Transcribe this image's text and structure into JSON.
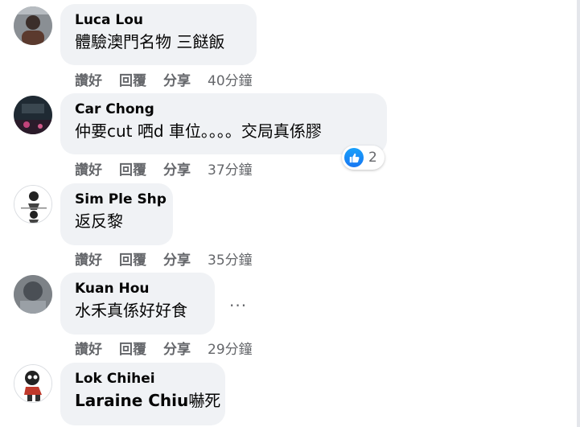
{
  "actions": {
    "like": "讚好",
    "reply": "回覆",
    "share": "分享"
  },
  "comments": [
    {
      "name": "Luca Lou",
      "text": "體驗澳門名物 三餸飯",
      "time": "40分鐘"
    },
    {
      "name": "Car Chong",
      "text": "仲要cut 哂d 車位。。。。交局真係膠",
      "time": "37分鐘",
      "reaction_count": "2",
      "reaction_icon": "like-icon"
    },
    {
      "name": "Sim Ple Shp",
      "text": "返反黎",
      "time": "35分鐘"
    },
    {
      "name": "Kuan Hou",
      "text": "水禾真係好好食",
      "time": "29分鐘",
      "more": "···"
    },
    {
      "name": "Lok Chihei",
      "mention": "Laraine Chiu",
      "text": "嚇死"
    }
  ],
  "colors": {
    "bubble": "#f0f2f5",
    "meta": "#65676b",
    "like": "#1877f2"
  }
}
